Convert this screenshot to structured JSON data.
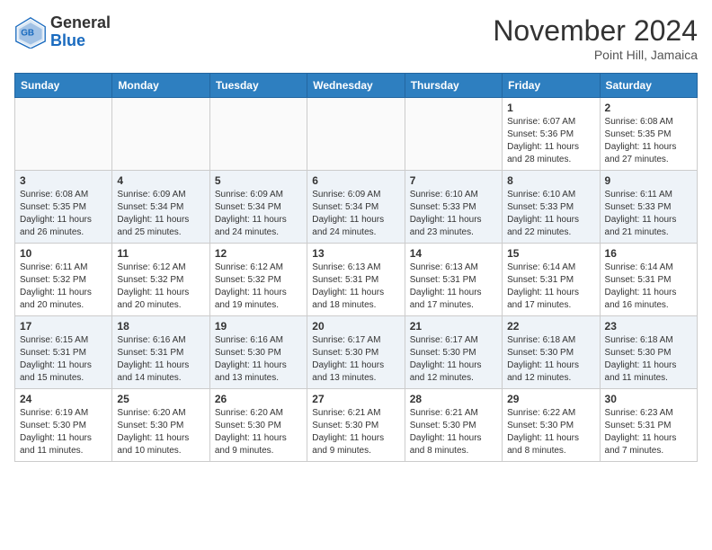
{
  "header": {
    "logo_general": "General",
    "logo_blue": "Blue",
    "month_title": "November 2024",
    "location": "Point Hill, Jamaica"
  },
  "days_of_week": [
    "Sunday",
    "Monday",
    "Tuesday",
    "Wednesday",
    "Thursday",
    "Friday",
    "Saturday"
  ],
  "weeks": [
    [
      {
        "day": "",
        "info": ""
      },
      {
        "day": "",
        "info": ""
      },
      {
        "day": "",
        "info": ""
      },
      {
        "day": "",
        "info": ""
      },
      {
        "day": "",
        "info": ""
      },
      {
        "day": "1",
        "info": "Sunrise: 6:07 AM\nSunset: 5:36 PM\nDaylight: 11 hours and 28 minutes."
      },
      {
        "day": "2",
        "info": "Sunrise: 6:08 AM\nSunset: 5:35 PM\nDaylight: 11 hours and 27 minutes."
      }
    ],
    [
      {
        "day": "3",
        "info": "Sunrise: 6:08 AM\nSunset: 5:35 PM\nDaylight: 11 hours and 26 minutes."
      },
      {
        "day": "4",
        "info": "Sunrise: 6:09 AM\nSunset: 5:34 PM\nDaylight: 11 hours and 25 minutes."
      },
      {
        "day": "5",
        "info": "Sunrise: 6:09 AM\nSunset: 5:34 PM\nDaylight: 11 hours and 24 minutes."
      },
      {
        "day": "6",
        "info": "Sunrise: 6:09 AM\nSunset: 5:34 PM\nDaylight: 11 hours and 24 minutes."
      },
      {
        "day": "7",
        "info": "Sunrise: 6:10 AM\nSunset: 5:33 PM\nDaylight: 11 hours and 23 minutes."
      },
      {
        "day": "8",
        "info": "Sunrise: 6:10 AM\nSunset: 5:33 PM\nDaylight: 11 hours and 22 minutes."
      },
      {
        "day": "9",
        "info": "Sunrise: 6:11 AM\nSunset: 5:33 PM\nDaylight: 11 hours and 21 minutes."
      }
    ],
    [
      {
        "day": "10",
        "info": "Sunrise: 6:11 AM\nSunset: 5:32 PM\nDaylight: 11 hours and 20 minutes."
      },
      {
        "day": "11",
        "info": "Sunrise: 6:12 AM\nSunset: 5:32 PM\nDaylight: 11 hours and 20 minutes."
      },
      {
        "day": "12",
        "info": "Sunrise: 6:12 AM\nSunset: 5:32 PM\nDaylight: 11 hours and 19 minutes."
      },
      {
        "day": "13",
        "info": "Sunrise: 6:13 AM\nSunset: 5:31 PM\nDaylight: 11 hours and 18 minutes."
      },
      {
        "day": "14",
        "info": "Sunrise: 6:13 AM\nSunset: 5:31 PM\nDaylight: 11 hours and 17 minutes."
      },
      {
        "day": "15",
        "info": "Sunrise: 6:14 AM\nSunset: 5:31 PM\nDaylight: 11 hours and 17 minutes."
      },
      {
        "day": "16",
        "info": "Sunrise: 6:14 AM\nSunset: 5:31 PM\nDaylight: 11 hours and 16 minutes."
      }
    ],
    [
      {
        "day": "17",
        "info": "Sunrise: 6:15 AM\nSunset: 5:31 PM\nDaylight: 11 hours and 15 minutes."
      },
      {
        "day": "18",
        "info": "Sunrise: 6:16 AM\nSunset: 5:31 PM\nDaylight: 11 hours and 14 minutes."
      },
      {
        "day": "19",
        "info": "Sunrise: 6:16 AM\nSunset: 5:30 PM\nDaylight: 11 hours and 13 minutes."
      },
      {
        "day": "20",
        "info": "Sunrise: 6:17 AM\nSunset: 5:30 PM\nDaylight: 11 hours and 13 minutes."
      },
      {
        "day": "21",
        "info": "Sunrise: 6:17 AM\nSunset: 5:30 PM\nDaylight: 11 hours and 12 minutes."
      },
      {
        "day": "22",
        "info": "Sunrise: 6:18 AM\nSunset: 5:30 PM\nDaylight: 11 hours and 12 minutes."
      },
      {
        "day": "23",
        "info": "Sunrise: 6:18 AM\nSunset: 5:30 PM\nDaylight: 11 hours and 11 minutes."
      }
    ],
    [
      {
        "day": "24",
        "info": "Sunrise: 6:19 AM\nSunset: 5:30 PM\nDaylight: 11 hours and 11 minutes."
      },
      {
        "day": "25",
        "info": "Sunrise: 6:20 AM\nSunset: 5:30 PM\nDaylight: 11 hours and 10 minutes."
      },
      {
        "day": "26",
        "info": "Sunrise: 6:20 AM\nSunset: 5:30 PM\nDaylight: 11 hours and 9 minutes."
      },
      {
        "day": "27",
        "info": "Sunrise: 6:21 AM\nSunset: 5:30 PM\nDaylight: 11 hours and 9 minutes."
      },
      {
        "day": "28",
        "info": "Sunrise: 6:21 AM\nSunset: 5:30 PM\nDaylight: 11 hours and 8 minutes."
      },
      {
        "day": "29",
        "info": "Sunrise: 6:22 AM\nSunset: 5:30 PM\nDaylight: 11 hours and 8 minutes."
      },
      {
        "day": "30",
        "info": "Sunrise: 6:23 AM\nSunset: 5:31 PM\nDaylight: 11 hours and 7 minutes."
      }
    ]
  ]
}
